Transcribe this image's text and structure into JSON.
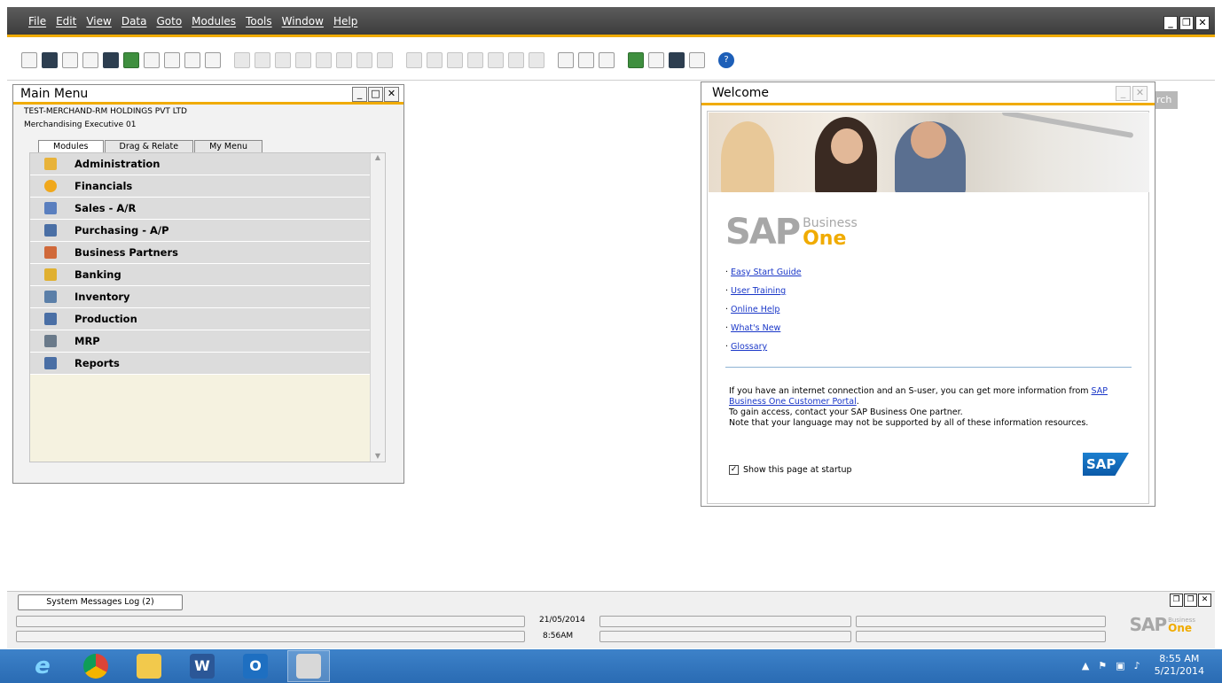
{
  "menubar": {
    "items": [
      "File",
      "Edit",
      "View",
      "Data",
      "Goto",
      "Modules",
      "Tools",
      "Window",
      "Help"
    ]
  },
  "main_menu": {
    "title": "Main Menu",
    "company": "TEST-MERCHAND-RM HOLDINGS PVT LTD",
    "user": "Merchandising Executive 01",
    "tabs": [
      "Modules",
      "Drag & Relate",
      "My Menu"
    ],
    "modules": [
      {
        "label": "Administration",
        "icon": "administration-icon",
        "color": "#e8b33a"
      },
      {
        "label": "Financials",
        "icon": "financials-icon",
        "color": "#f0a81c"
      },
      {
        "label": "Sales - A/R",
        "icon": "sales-icon",
        "color": "#5a7fbf"
      },
      {
        "label": "Purchasing - A/P",
        "icon": "purchasing-icon",
        "color": "#4a6fa5"
      },
      {
        "label": "Business Partners",
        "icon": "business-partners-icon",
        "color": "#d0693a"
      },
      {
        "label": "Banking",
        "icon": "banking-icon",
        "color": "#e0b030"
      },
      {
        "label": "Inventory",
        "icon": "inventory-icon",
        "color": "#5b7fa8"
      },
      {
        "label": "Production",
        "icon": "production-icon",
        "color": "#4a6fa5"
      },
      {
        "label": "MRP",
        "icon": "mrp-icon",
        "color": "#6a7a8a"
      },
      {
        "label": "Reports",
        "icon": "reports-icon",
        "color": "#4a6fa5"
      }
    ]
  },
  "welcome": {
    "title": "Welcome",
    "logo_sap": "SAP",
    "logo_business": "Business",
    "logo_one": "One",
    "links": [
      "Easy Start Guide",
      "User Training",
      "Online Help",
      "What's New",
      "Glossary"
    ],
    "info_line1": "If you have an internet connection and an S-user, you can get more information from ",
    "info_link": "SAP Business One Customer Portal",
    "info_line2": "To gain access, contact your SAP Business One partner.",
    "info_line3": "Note that your language may not be supported by all of these information resources.",
    "show_at_startup": "Show this page at startup",
    "sap_badge": "SAP"
  },
  "search_stub": "rch",
  "status": {
    "syslog_tab": "System Messages Log (2)",
    "date": "21/05/2014",
    "time": "8:56AM"
  },
  "bottom_logo": {
    "sap": "SAP",
    "business": "Business",
    "one": "One"
  },
  "taskbar": {
    "clock_time": "8:55 AM",
    "clock_date": "5/21/2014"
  },
  "colors": {
    "accent": "#f0ab00",
    "link": "#1a37c8",
    "taskbar": "#2a6bb3"
  }
}
